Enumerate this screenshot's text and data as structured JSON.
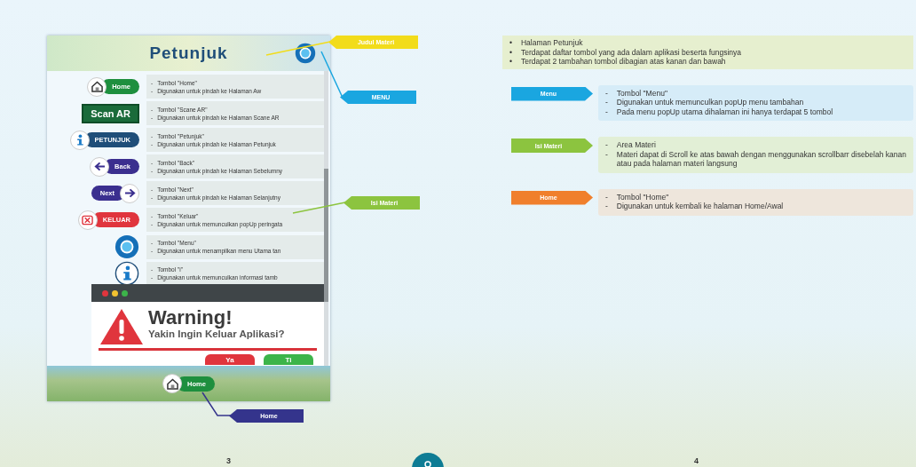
{
  "left_page": {
    "screen": {
      "title": "Petunjuk",
      "rows": [
        {
          "kind": "home",
          "button_label": "Home",
          "bullet": "-",
          "lines": [
            "Tombol \"Home\"",
            "Digunakan untuk pindah ke Halaman Aw"
          ]
        },
        {
          "kind": "scan",
          "button_label": "Scan AR",
          "bullet": "-",
          "lines": [
            "Tombol \"Scane AR\"",
            "Digunakan untuk pindah ke Halaman Scane AR"
          ]
        },
        {
          "kind": "petunjuk",
          "button_label": "PETUNJUK",
          "bullet": "-",
          "lines": [
            "Tombol \"Petunjuk\"",
            "Digunakan untuk pindah ke Halaman Petunjuk"
          ]
        },
        {
          "kind": "back",
          "button_label": "Back",
          "bullet": "-",
          "lines": [
            "Tombol \"Back\"",
            "Digunakan untuk pindah ke Halaman Sebelumny"
          ]
        },
        {
          "kind": "next",
          "button_label": "Next",
          "bullet": "-",
          "lines": [
            "Tombol \"Next\"",
            "Digunakan untuk pindah ke Halaman Selanjutny"
          ]
        },
        {
          "kind": "keluar",
          "button_label": "KELUAR",
          "bullet": "-",
          "lines": [
            "Tombol \"Keluar\"",
            "Digunakan untuk memunculkan popUp peringata"
          ]
        },
        {
          "kind": "menu",
          "bullet": "-",
          "lines": [
            "Tombol \"Menu\"",
            "Digunakan untuk menampilkan menu Utama tan"
          ]
        },
        {
          "kind": "info",
          "bullet": "-",
          "lines": [
            "Tombol \"i\"",
            "Digunakan untuk memunculkan informasi tamb"
          ]
        }
      ],
      "dialog": {
        "title": "Warning!",
        "message": "Yakin Ingin Keluar Aplikasi?",
        "buttons": [
          {
            "label": "Ya",
            "kind": "yes"
          },
          {
            "label": "Ti",
            "kind": "no"
          }
        ]
      },
      "bottom_bar": {
        "button_label": "Home"
      }
    },
    "callouts": [
      {
        "label": "Judul Materi",
        "color": "#f2dc1a"
      },
      {
        "label": "MENU",
        "color": "#1aa6e0"
      },
      {
        "label": "Isi Materi",
        "color": "#8cc43f"
      },
      {
        "label": "Home",
        "color": "#34348c"
      }
    ],
    "page_number": "3"
  },
  "right_page": {
    "summary": {
      "bullet": "•",
      "lines": [
        "Halaman Petunjuk",
        "Terdapat daftar tombol yang ada dalam aplikasi beserta fungsinya",
        "Terdapat 2 tambahan tombol dibagian atas kanan dan bawah"
      ]
    },
    "sections": [
      {
        "label": "Menu",
        "color": "#1aa6e0",
        "bullet": "-",
        "lines": [
          "Tombol \"Menu\"",
          "Digunakan untuk memunculkan popUp menu tambahan",
          "Pada menu popUp utama dihalaman ini hanya terdapat 5 tombol"
        ]
      },
      {
        "label": "Isi Materi",
        "color": "#8cc43f",
        "bullet": "-",
        "lines": [
          "Area Materi",
          "Materi dapat di Scroll ke atas bawah dengan menggunakan scrollbarr disebelah kanan atau pada halaman materi langsung"
        ]
      },
      {
        "label": "Home",
        "color": "#f07f2c",
        "bullet": "-",
        "lines": [
          "Tombol \"Home\"",
          "Digunakan untuk kembali ke halaman Home/Awal"
        ]
      }
    ],
    "page_number": "4"
  }
}
